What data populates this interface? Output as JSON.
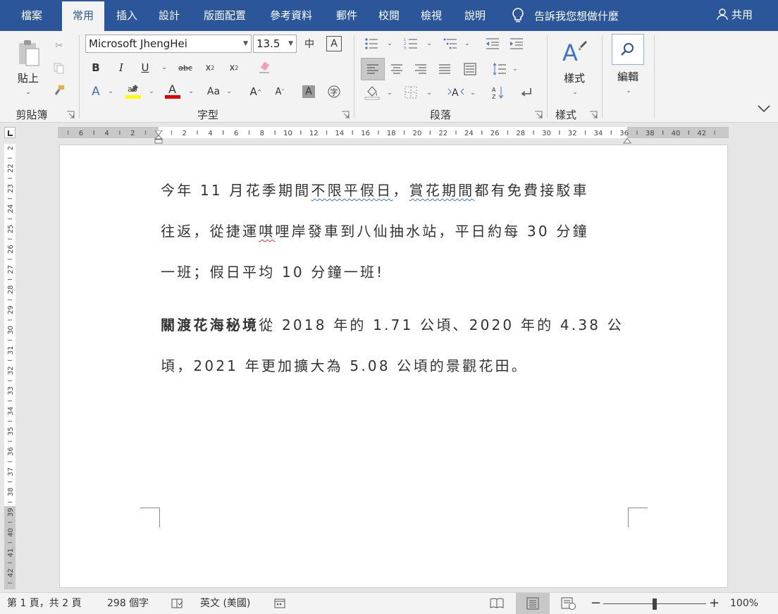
{
  "tabs": [
    "檔案",
    "常用",
    "插入",
    "設計",
    "版面配置",
    "參考資料",
    "郵件",
    "校閱",
    "檢視",
    "說明"
  ],
  "tell_me": "告訴我您想做什麼",
  "share": "共用",
  "clipboard": {
    "paste": "貼上",
    "group": "剪貼簿"
  },
  "font": {
    "name": "Microsoft JhengHei",
    "size": "13.5",
    "group": "字型"
  },
  "paragraph": {
    "group": "段落"
  },
  "styles": {
    "label": "樣式",
    "group": "樣式"
  },
  "editing": {
    "label": "編輯"
  },
  "ruler": {
    "h_ticks": [
      "6",
      "4",
      "2",
      "2",
      "4",
      "6",
      "8",
      "10",
      "12",
      "14",
      "16",
      "18",
      "20",
      "22",
      "24",
      "26",
      "28",
      "30",
      "32",
      "34",
      "36",
      "38",
      "40",
      "42"
    ],
    "v_ticks": [
      "2",
      "22",
      "23",
      "24",
      "25",
      "26",
      "27",
      "28",
      "29",
      "30",
      "31",
      "32",
      "33",
      "34",
      "35",
      "36",
      "37",
      "38",
      "39",
      "40",
      "41",
      "42"
    ]
  },
  "document": {
    "p1": {
      "l1a": "今年 11 月花季期間",
      "l1b": "不限平假日",
      "l1c": "，",
      "l1d": "賞花期間",
      "l1e": "都有免費接駁車",
      "l2a": "往返，從捷運",
      "l2b": "唭",
      "l2c": "哩岸發車到八仙抽水站，平日約每 30 分鐘",
      "l3": "一班；假日平均 10 分鐘一班!"
    },
    "p2": {
      "bold": "關渡花海秘境",
      "l1": "從 2018 年的 1.71 公頃、2020 年的 4.38 公",
      "l2": "頃，2021 年更加擴大為 5.08 公頃的景觀花田。"
    }
  },
  "status": {
    "page": "第 1 頁，共 2 頁",
    "words": "298 個字",
    "language": "英文 (美國)",
    "zoom_percent": "100%",
    "zoom_level": 0.5
  },
  "colors": {
    "brand": "#2b579a",
    "highlight": "#ffff00",
    "font_color": "#e00000"
  }
}
